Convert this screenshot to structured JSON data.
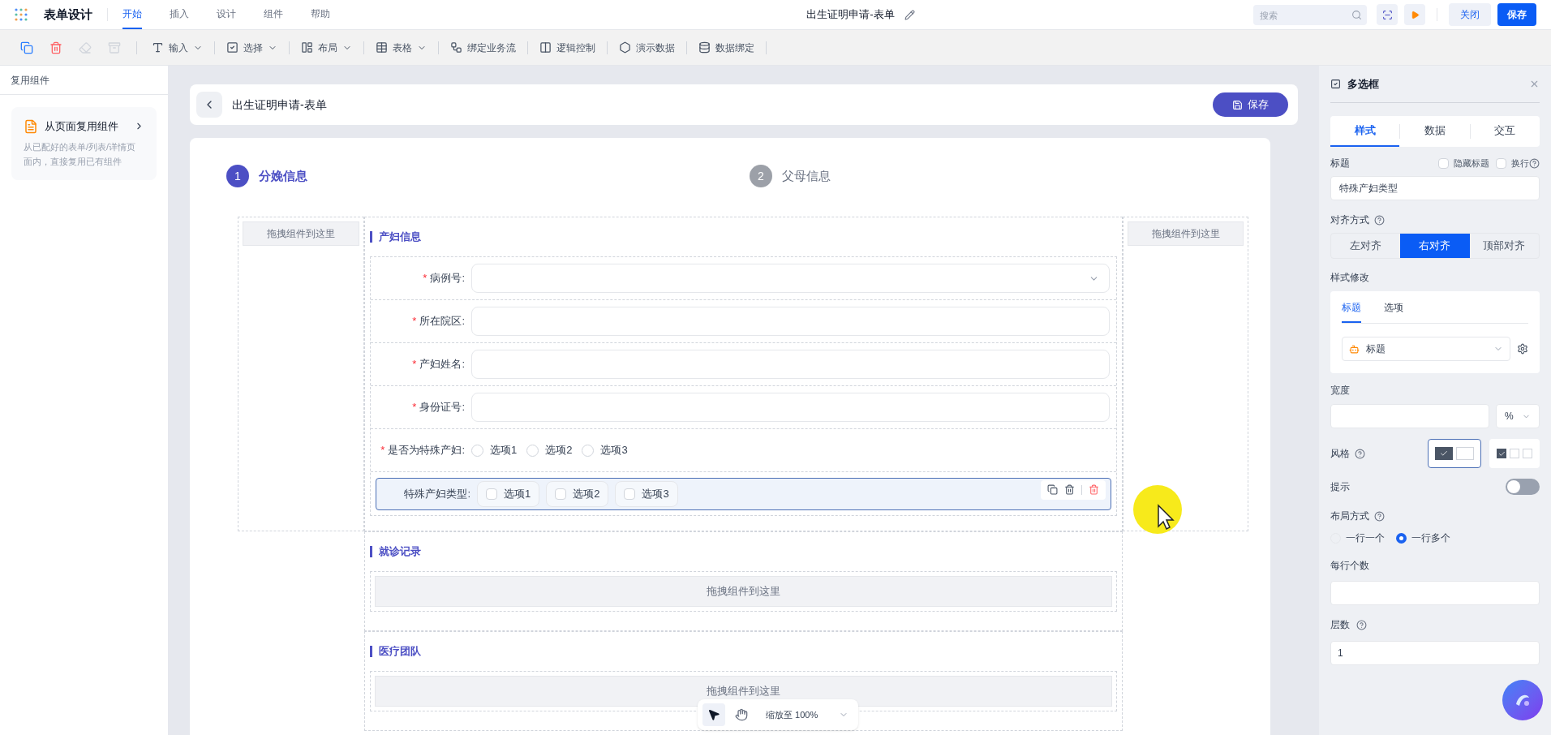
{
  "app": {
    "title": "表单设计",
    "menu": [
      {
        "label": "开始",
        "selected": true
      },
      {
        "label": "插入",
        "selected": false
      },
      {
        "label": "设计",
        "selected": false
      },
      {
        "label": "组件",
        "selected": false
      },
      {
        "label": "帮助",
        "selected": false
      }
    ]
  },
  "document_title": "出生证明申请-表单",
  "search": {
    "placeholder": "搜索"
  },
  "actions": {
    "close": "关闭",
    "save": "保存"
  },
  "toolbar": {
    "icon_buttons": [
      {
        "disabled": false
      },
      {
        "disabled": false
      },
      {
        "disabled": true
      },
      {
        "disabled": true
      }
    ],
    "items": [
      {
        "label": "输入",
        "dropdown": true
      },
      {
        "label": "选择",
        "dropdown": true
      },
      {
        "label": "布局",
        "dropdown": true
      },
      {
        "label": "表格",
        "dropdown": true
      },
      {
        "label": "绑定业务流",
        "dropdown": false
      },
      {
        "label": "逻辑控制",
        "dropdown": false
      },
      {
        "label": "演示数据",
        "dropdown": false
      },
      {
        "label": "数据绑定",
        "dropdown": false
      }
    ]
  },
  "sidebar": {
    "title": "复用组件",
    "card": {
      "title": "从页面复用组件",
      "description": "从已配好的表单/列表/详情页面内，直接复用已有组件"
    }
  },
  "form_header": {
    "title": "出生证明申请-表单",
    "save": "保存"
  },
  "steps": [
    {
      "number": "1",
      "label": "分娩信息",
      "selected": true
    },
    {
      "number": "2",
      "label": "父母信息",
      "selected": false
    }
  ],
  "drop_hint_left": "拖拽组件到这里",
  "drop_hint_right": "拖拽组件到这里",
  "sections": [
    {
      "title": "产妇信息",
      "fields": [
        {
          "kind": "select",
          "label": "病例号:",
          "required_mark": "*"
        },
        {
          "kind": "text",
          "label": "所在院区:",
          "required_mark": "*"
        },
        {
          "kind": "text",
          "label": "产妇姓名:",
          "required_mark": "*"
        },
        {
          "kind": "text",
          "label": "身份证号:",
          "required_mark": "*"
        },
        {
          "kind": "radio",
          "label": "是否为特殊产妇:",
          "required_mark": "*",
          "options": [
            {
              "label": "选项1",
              "selected": false
            },
            {
              "label": "选项2",
              "selected": false
            },
            {
              "label": "选项3",
              "selected": false
            }
          ]
        },
        {
          "kind": "checkbox",
          "label": "特殊产妇类型:",
          "selected": true,
          "options": [
            {
              "label": "选项1",
              "checked": false
            },
            {
              "label": "选项2",
              "checked": false
            },
            {
              "label": "选项3",
              "checked": false
            }
          ]
        }
      ]
    },
    {
      "title": "就诊记录",
      "drop_hint": "拖拽组件到这里"
    },
    {
      "title": "医疗团队",
      "drop_hint": "拖拽组件到这里"
    }
  ],
  "zoom_bar": {
    "tools": [
      {
        "selected": true
      },
      {
        "selected": false
      }
    ],
    "label": "缩放至 100%"
  },
  "panel": {
    "title": "多选框",
    "tabs": [
      {
        "label": "样式",
        "selected": true
      },
      {
        "label": "数据",
        "selected": false
      },
      {
        "label": "交互",
        "selected": false
      }
    ],
    "title_field": {
      "label": "标题",
      "hide_title": {
        "label": "隐藏标题",
        "checked": false
      },
      "wrap": {
        "label": "换行",
        "checked": false
      },
      "value": "特殊产妇类型"
    },
    "align": {
      "label": "对齐方式",
      "options": [
        {
          "label": "左对齐",
          "selected": false
        },
        {
          "label": "右对齐",
          "selected": true
        },
        {
          "label": "顶部对齐",
          "selected": false
        }
      ]
    },
    "style_edit": {
      "label": "样式修改",
      "tabs": [
        {
          "label": "标题",
          "selected": true
        },
        {
          "label": "选项",
          "selected": false
        }
      ],
      "select_value": "标题"
    },
    "width": {
      "label": "宽度",
      "unit": "%"
    },
    "style": {
      "label": "风格",
      "options": [
        {
          "selected": true
        },
        {
          "selected": false
        }
      ]
    },
    "hint": {
      "label": "提示",
      "on": false
    },
    "layout": {
      "label": "布局方式",
      "options": [
        {
          "label": "一行一个",
          "selected": false
        },
        {
          "label": "一行多个",
          "selected": true
        }
      ]
    },
    "per_row": {
      "label": "每行个数"
    },
    "levels": {
      "label": "层数",
      "value": "1"
    }
  }
}
